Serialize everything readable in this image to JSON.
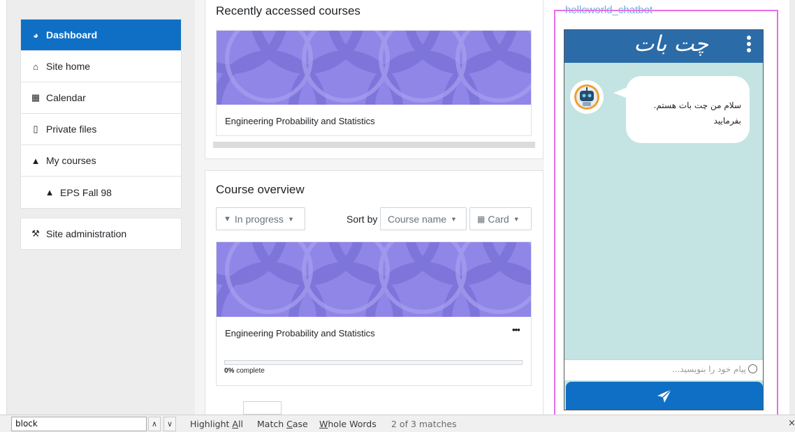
{
  "nav": {
    "items": [
      {
        "icon": "dashboard-icon",
        "glyph": "◕",
        "label": "Dashboard"
      },
      {
        "icon": "home-icon",
        "glyph": "⌂",
        "label": "Site home"
      },
      {
        "icon": "calendar-icon",
        "glyph": "▦",
        "label": "Calendar"
      },
      {
        "icon": "file-icon",
        "glyph": "▯",
        "label": "Private files"
      },
      {
        "icon": "graduation-cap-icon",
        "glyph": "▲",
        "label": "My courses"
      },
      {
        "icon": "graduation-cap-icon",
        "glyph": "▲",
        "label": "EPS Fall 98"
      }
    ],
    "admin": {
      "icon": "wrench-icon",
      "glyph": "⚒",
      "label": "Site administration"
    }
  },
  "recent": {
    "title": "Recently accessed courses",
    "course_name": "Engineering Probability and Statistics"
  },
  "overview": {
    "title": "Course overview",
    "filter_label": "In progress",
    "sort_by_label": "Sort by",
    "sort_value": "Course name",
    "view_label": "Card",
    "course_name": "Engineering Probability and Statistics",
    "more_label": "•••",
    "progress_percent": "0%",
    "progress_suffix": " complete",
    "progress_fraction": 0
  },
  "chatbot": {
    "block_title": "helloworld_chatbot",
    "header_title": "چت بات",
    "message_line1": "سلام من چت بات هستم.",
    "message_line2": "بفرمایید",
    "input_placeholder": "پیام خود را بنویسید...",
    "accent_color": "#2b6ba8",
    "send_color": "#0f6fc5"
  },
  "findbar": {
    "query": "block",
    "up_arrow": "∧",
    "down_arrow": "∨",
    "highlight_all_pre": "Highlight ",
    "highlight_all_key": "A",
    "highlight_all_post": "ll",
    "match_case_pre": "Match ",
    "match_case_key": "C",
    "match_case_post": "ase",
    "whole_words_key": "W",
    "whole_words_post": "hole Words",
    "match_count": "2 of 3 matches",
    "close_glyph": "×"
  }
}
